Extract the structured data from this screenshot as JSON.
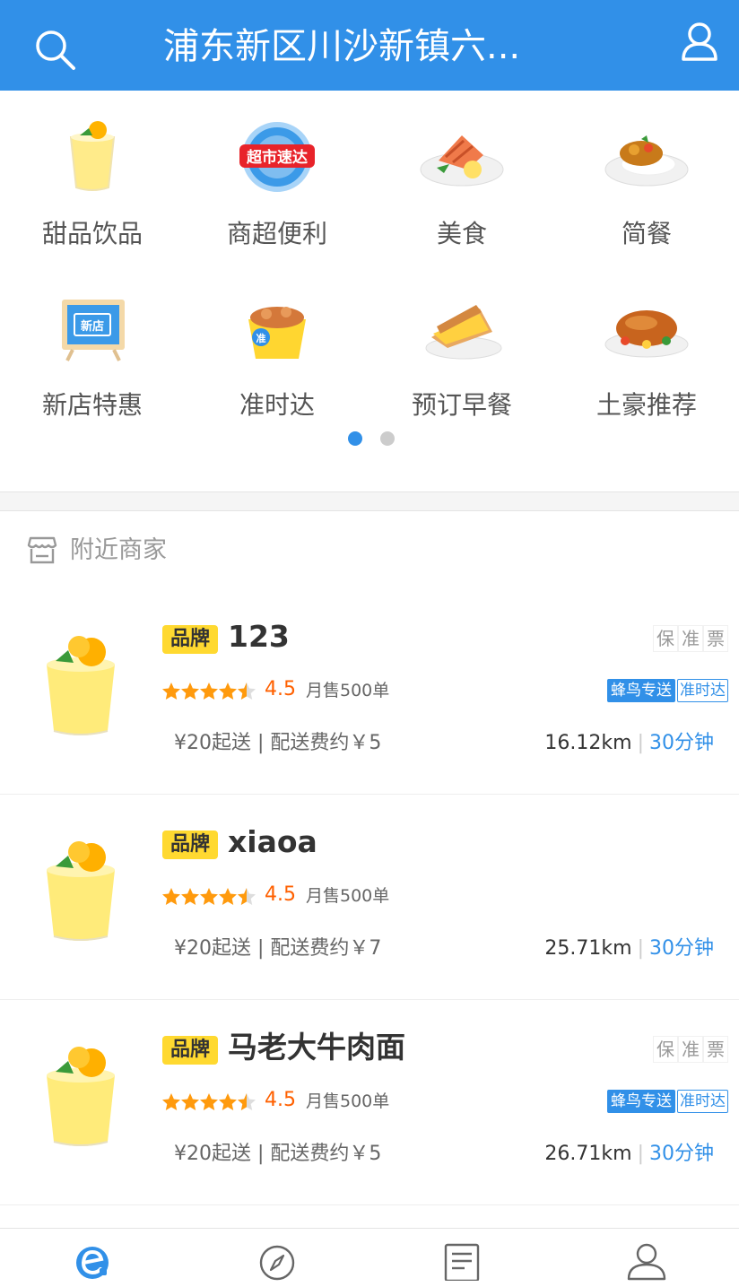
{
  "header": {
    "title": "浦东新区川沙新镇六...",
    "search_icon": "search-icon",
    "user_icon": "user-icon"
  },
  "categories": [
    {
      "label": "甜品饮品",
      "icon": "drink-icon"
    },
    {
      "label": "商超便利",
      "icon": "supermarket-icon"
    },
    {
      "label": "美食",
      "icon": "food-icon"
    },
    {
      "label": "简餐",
      "icon": "meal-icon"
    },
    {
      "label": "新店特惠",
      "icon": "new-shop-icon"
    },
    {
      "label": "准时达",
      "icon": "on-time-icon"
    },
    {
      "label": "预订早餐",
      "icon": "breakfast-icon"
    },
    {
      "label": "土豪推荐",
      "icon": "recommend-icon"
    }
  ],
  "pager": {
    "pages": 2,
    "active": 1
  },
  "nearby": {
    "title": "附近商家"
  },
  "shops": [
    {
      "brand": "品牌",
      "name": "123",
      "guarantees": [
        "保",
        "准",
        "票"
      ],
      "rating": "4.5",
      "sales": "月售500单",
      "delivery_tag": "蜂鸟专送",
      "ontime_tag": "准时达",
      "fee": "¥20起送 | 配送费约￥5",
      "distance": "16.12km",
      "separator": "|",
      "time": "30分钟"
    },
    {
      "brand": "品牌",
      "name": "xiaoa",
      "guarantees": [],
      "rating": "4.5",
      "sales": "月售500单",
      "delivery_tag": "",
      "ontime_tag": "",
      "fee": "¥20起送 | 配送费约￥7",
      "distance": "25.71km",
      "separator": "|",
      "time": "30分钟"
    },
    {
      "brand": "品牌",
      "name": "马老大牛肉面",
      "guarantees": [
        "保",
        "准",
        "票"
      ],
      "rating": "4.5",
      "sales": "月售500单",
      "delivery_tag": "蜂鸟专送",
      "ontime_tag": "准时达",
      "fee": "¥20起送 | 配送费约￥5",
      "distance": "26.71km",
      "separator": "|",
      "time": "30分钟"
    }
  ],
  "tabbar": [
    {
      "icon": "home-icon",
      "active": true
    },
    {
      "icon": "compass-icon",
      "active": false
    },
    {
      "icon": "order-icon",
      "active": false
    },
    {
      "icon": "profile-icon",
      "active": false
    }
  ],
  "colors": {
    "primary": "#3190e8",
    "brand_tag": "#ffd930",
    "rating": "#ff6000",
    "star": "#ff9a0d"
  }
}
